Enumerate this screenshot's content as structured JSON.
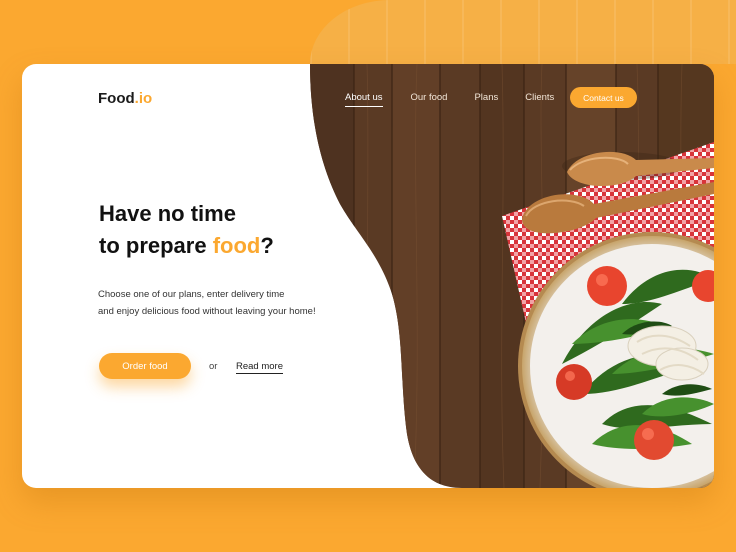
{
  "brand": {
    "name": "Food",
    "suffix": ".io"
  },
  "nav": {
    "items": [
      "About us",
      "Our food",
      "Plans",
      "Clients"
    ],
    "active": "About us",
    "contact_label": "Contact us"
  },
  "hero": {
    "headline_line1": "Have no time",
    "headline_line2_prefix": "to prepare ",
    "headline_accent": "food",
    "headline_suffix": "?",
    "subtext_line1": "Choose one of our plans, enter delivery time",
    "subtext_line2": "and enjoy delicious food without leaving your home!",
    "primary_cta": "Order food",
    "separator": "or",
    "secondary_cta": "Read more"
  },
  "colors": {
    "accent": "#fba830",
    "background": "#fba830",
    "card": "#ffffff",
    "wood": "#5a3a24",
    "text": "#111111"
  },
  "icons": [
    "wooden-spoon-icon",
    "salad-plate-image"
  ]
}
